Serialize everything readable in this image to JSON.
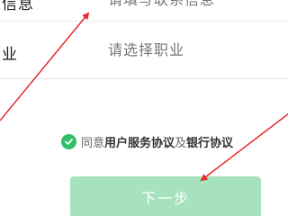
{
  "form": {
    "top_row": {
      "label": "人信息",
      "placeholder": "请填写联系信息"
    },
    "job_row": {
      "label": "职业",
      "placeholder": "请选择职业"
    }
  },
  "agreement": {
    "prefix": "同意",
    "user_terms": "用户服务协议",
    "joiner": "及",
    "bank_terms": "银行协议",
    "checked": true,
    "check_color": "#2fbf68"
  },
  "next_button": {
    "label": "下一步",
    "enabled": false,
    "color": "#a6e2bd"
  },
  "annotation_color": "#e52b2b"
}
